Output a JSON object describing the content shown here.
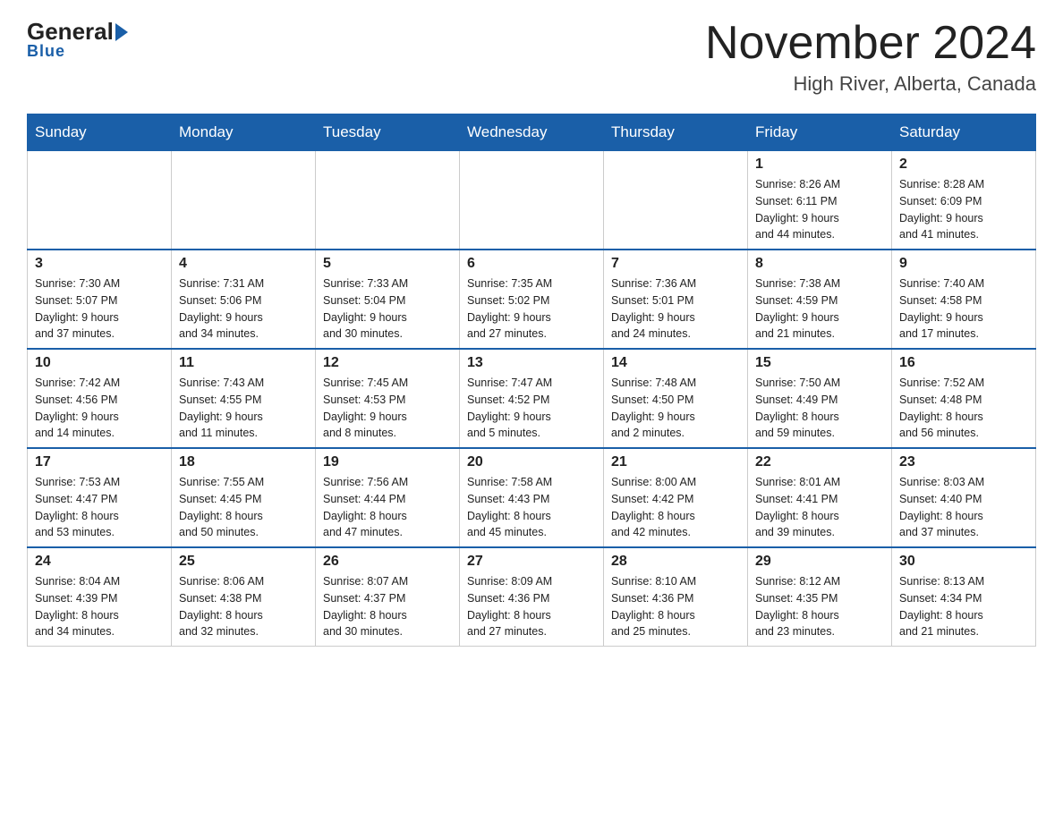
{
  "header": {
    "logo": {
      "general": "General",
      "blue": "Blue"
    },
    "title": "November 2024",
    "location": "High River, Alberta, Canada"
  },
  "weekdays": [
    "Sunday",
    "Monday",
    "Tuesday",
    "Wednesday",
    "Thursday",
    "Friday",
    "Saturday"
  ],
  "weeks": [
    [
      {
        "day": "",
        "info": ""
      },
      {
        "day": "",
        "info": ""
      },
      {
        "day": "",
        "info": ""
      },
      {
        "day": "",
        "info": ""
      },
      {
        "day": "",
        "info": ""
      },
      {
        "day": "1",
        "info": "Sunrise: 8:26 AM\nSunset: 6:11 PM\nDaylight: 9 hours\nand 44 minutes."
      },
      {
        "day": "2",
        "info": "Sunrise: 8:28 AM\nSunset: 6:09 PM\nDaylight: 9 hours\nand 41 minutes."
      }
    ],
    [
      {
        "day": "3",
        "info": "Sunrise: 7:30 AM\nSunset: 5:07 PM\nDaylight: 9 hours\nand 37 minutes."
      },
      {
        "day": "4",
        "info": "Sunrise: 7:31 AM\nSunset: 5:06 PM\nDaylight: 9 hours\nand 34 minutes."
      },
      {
        "day": "5",
        "info": "Sunrise: 7:33 AM\nSunset: 5:04 PM\nDaylight: 9 hours\nand 30 minutes."
      },
      {
        "day": "6",
        "info": "Sunrise: 7:35 AM\nSunset: 5:02 PM\nDaylight: 9 hours\nand 27 minutes."
      },
      {
        "day": "7",
        "info": "Sunrise: 7:36 AM\nSunset: 5:01 PM\nDaylight: 9 hours\nand 24 minutes."
      },
      {
        "day": "8",
        "info": "Sunrise: 7:38 AM\nSunset: 4:59 PM\nDaylight: 9 hours\nand 21 minutes."
      },
      {
        "day": "9",
        "info": "Sunrise: 7:40 AM\nSunset: 4:58 PM\nDaylight: 9 hours\nand 17 minutes."
      }
    ],
    [
      {
        "day": "10",
        "info": "Sunrise: 7:42 AM\nSunset: 4:56 PM\nDaylight: 9 hours\nand 14 minutes."
      },
      {
        "day": "11",
        "info": "Sunrise: 7:43 AM\nSunset: 4:55 PM\nDaylight: 9 hours\nand 11 minutes."
      },
      {
        "day": "12",
        "info": "Sunrise: 7:45 AM\nSunset: 4:53 PM\nDaylight: 9 hours\nand 8 minutes."
      },
      {
        "day": "13",
        "info": "Sunrise: 7:47 AM\nSunset: 4:52 PM\nDaylight: 9 hours\nand 5 minutes."
      },
      {
        "day": "14",
        "info": "Sunrise: 7:48 AM\nSunset: 4:50 PM\nDaylight: 9 hours\nand 2 minutes."
      },
      {
        "day": "15",
        "info": "Sunrise: 7:50 AM\nSunset: 4:49 PM\nDaylight: 8 hours\nand 59 minutes."
      },
      {
        "day": "16",
        "info": "Sunrise: 7:52 AM\nSunset: 4:48 PM\nDaylight: 8 hours\nand 56 minutes."
      }
    ],
    [
      {
        "day": "17",
        "info": "Sunrise: 7:53 AM\nSunset: 4:47 PM\nDaylight: 8 hours\nand 53 minutes."
      },
      {
        "day": "18",
        "info": "Sunrise: 7:55 AM\nSunset: 4:45 PM\nDaylight: 8 hours\nand 50 minutes."
      },
      {
        "day": "19",
        "info": "Sunrise: 7:56 AM\nSunset: 4:44 PM\nDaylight: 8 hours\nand 47 minutes."
      },
      {
        "day": "20",
        "info": "Sunrise: 7:58 AM\nSunset: 4:43 PM\nDaylight: 8 hours\nand 45 minutes."
      },
      {
        "day": "21",
        "info": "Sunrise: 8:00 AM\nSunset: 4:42 PM\nDaylight: 8 hours\nand 42 minutes."
      },
      {
        "day": "22",
        "info": "Sunrise: 8:01 AM\nSunset: 4:41 PM\nDaylight: 8 hours\nand 39 minutes."
      },
      {
        "day": "23",
        "info": "Sunrise: 8:03 AM\nSunset: 4:40 PM\nDaylight: 8 hours\nand 37 minutes."
      }
    ],
    [
      {
        "day": "24",
        "info": "Sunrise: 8:04 AM\nSunset: 4:39 PM\nDaylight: 8 hours\nand 34 minutes."
      },
      {
        "day": "25",
        "info": "Sunrise: 8:06 AM\nSunset: 4:38 PM\nDaylight: 8 hours\nand 32 minutes."
      },
      {
        "day": "26",
        "info": "Sunrise: 8:07 AM\nSunset: 4:37 PM\nDaylight: 8 hours\nand 30 minutes."
      },
      {
        "day": "27",
        "info": "Sunrise: 8:09 AM\nSunset: 4:36 PM\nDaylight: 8 hours\nand 27 minutes."
      },
      {
        "day": "28",
        "info": "Sunrise: 8:10 AM\nSunset: 4:36 PM\nDaylight: 8 hours\nand 25 minutes."
      },
      {
        "day": "29",
        "info": "Sunrise: 8:12 AM\nSunset: 4:35 PM\nDaylight: 8 hours\nand 23 minutes."
      },
      {
        "day": "30",
        "info": "Sunrise: 8:13 AM\nSunset: 4:34 PM\nDaylight: 8 hours\nand 21 minutes."
      }
    ]
  ]
}
